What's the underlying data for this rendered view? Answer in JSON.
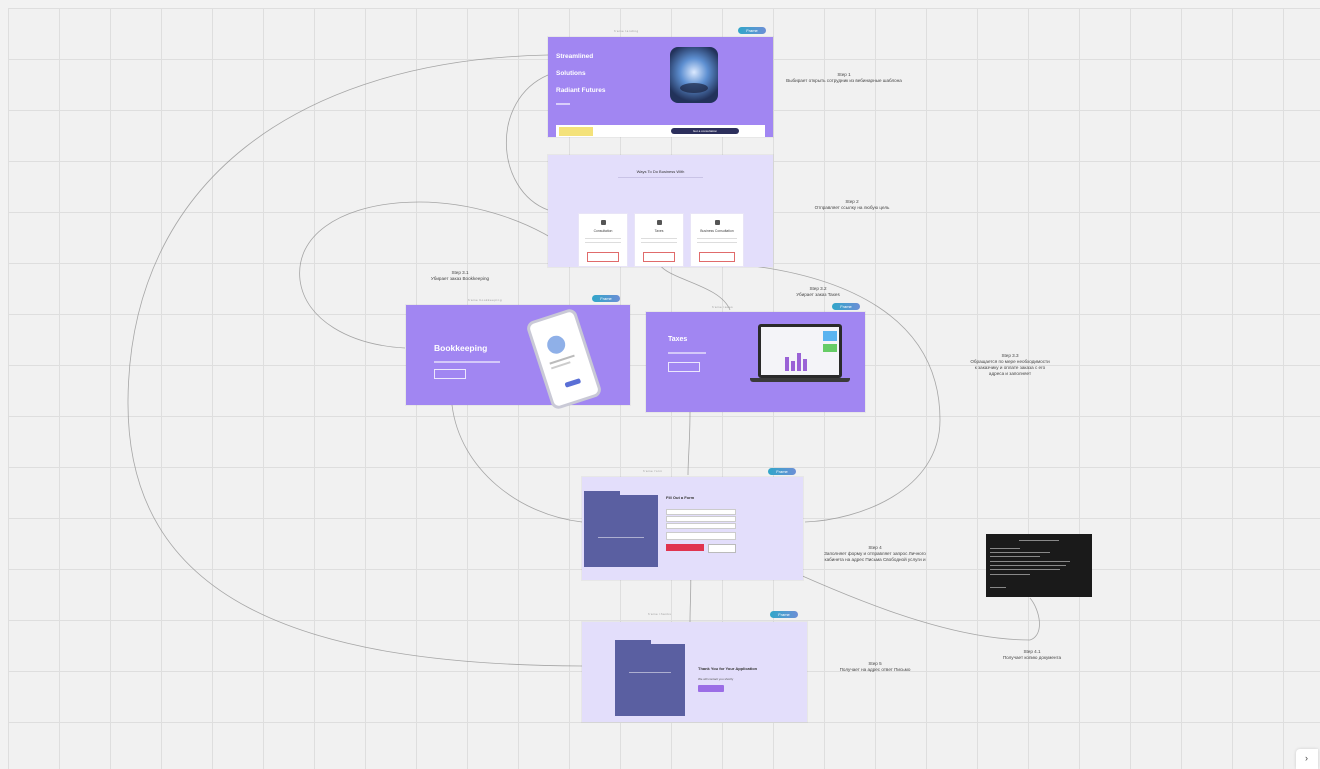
{
  "notes": {
    "step1": [
      "Step 1",
      "Выбирает открыть сотрудник из вебинарные шаблона"
    ],
    "step2": [
      "Step 2",
      "Отправляет ссылку на любую цель"
    ],
    "step3": [
      "Step 3",
      "Выбирает одну из Услуг, то от компании"
    ],
    "step31": [
      "Step 3.1",
      "Убирает заказ Bookkeeping"
    ],
    "step32": [
      "Step 3.2",
      "Убирает заказ Taxes"
    ],
    "step33": [
      "Step 3.3",
      "Обращается по мере необходимости",
      "к заказчику и оплате заказа с его",
      "адреса и заполняет"
    ],
    "step4": [
      "Step 4",
      "Заполняет форму и отправляет запрос Личного",
      "кабинета на адрес Письма Свободной услуги и",
      "заполняет"
    ],
    "step41": [
      "Step 4.1",
      "Получает копию документа"
    ],
    "step5": [
      "Step 5",
      "Получает на адрес ответ Письмо"
    ]
  },
  "hero": {
    "lines": [
      "Streamlined",
      "Solutions",
      "Radiant Futures"
    ],
    "cta": "Get a consultation"
  },
  "services": {
    "heading": "Ways To Do Business With",
    "cards": [
      "Consultation",
      "Taxes",
      "Business Consultation"
    ]
  },
  "bookkeeping": {
    "title": "Bookkeeping"
  },
  "taxes": {
    "title": "Taxes"
  },
  "form": {
    "heading": "Fill Out a Form"
  },
  "thanks": {
    "title": "Thank You for Your Application",
    "sub": "We will contact you shortly"
  },
  "badges": [
    "Frame",
    "Frame",
    "Frame",
    "Frame",
    "Frame",
    "Frame"
  ],
  "frame_titles": [
    "frame landing",
    "frame services",
    "frame bookkeeping",
    "frame taxes",
    "frame form",
    "frame thanks"
  ],
  "colors": {
    "purple": "#a186f2",
    "lavender": "#e3defb",
    "navy": "#5a5fa1",
    "submit_red": "#e0344f"
  }
}
